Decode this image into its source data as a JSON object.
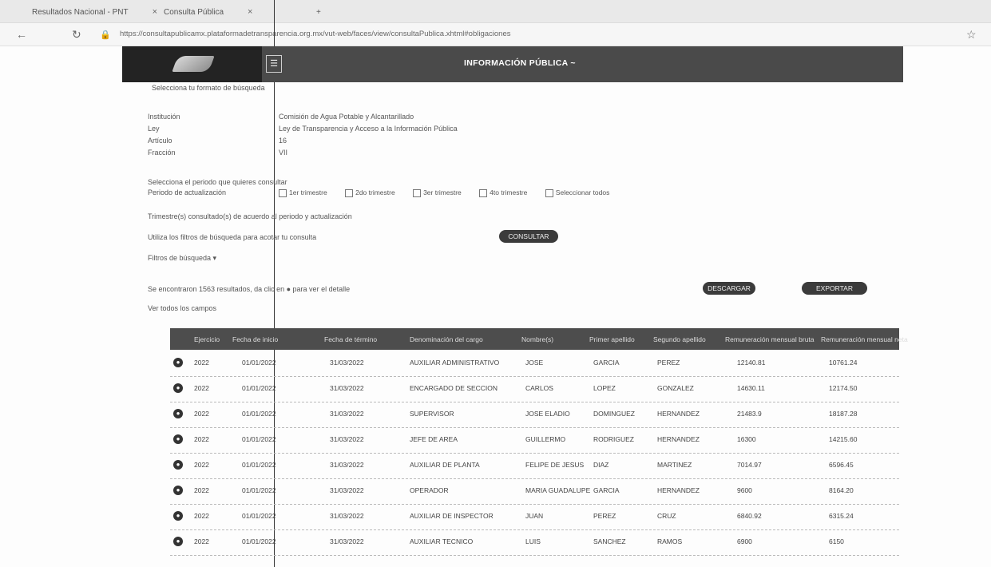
{
  "browser": {
    "tab1": "Resultados Nacional - PNT",
    "tab2": "Consulta Pública",
    "new_tab": "+",
    "url": "https://consultapublicamx.plataformadetransparencia.org.mx/vut-web/faces/view/consultaPublica.xhtml#obligaciones"
  },
  "header": {
    "title": "INFORMACIÓN PÚBLICA ~",
    "menu_icon": "menu-icon"
  },
  "subtitle": "Selecciona tu formato de búsqueda",
  "fields": [
    {
      "label": "Institución",
      "value": "Comisión de Agua Potable y Alcantarillado"
    },
    {
      "label": "Ley",
      "value": "Ley de Transparencia y Acceso a la Información Pública"
    },
    {
      "label": "Artículo",
      "value": "16"
    },
    {
      "label": "Fracción",
      "value": "VII"
    }
  ],
  "period_prompt": "Selecciona el periodo que quieres consultar",
  "period_label": "Periodo de actualización",
  "periods": [
    "1er trimestre",
    "2do trimestre",
    "3er trimestre",
    "4to trimestre",
    "Seleccionar todos"
  ],
  "trimester_note": "Trimestre(s) consultado(s) de acuerdo al periodo y actualización",
  "filter_note": "Utiliza los filtros de búsqueda para acotar tu consulta",
  "filter_toggle": "Filtros de búsqueda ▾",
  "consult_button": "CONSULTAR",
  "results_note": "Se encontraron 1563 resultados, da clic en ● para ver el detalle",
  "all_fields": "Ver todos los campos",
  "download_button": "DESCARGAR",
  "export_button": "EXPORTAR",
  "table": {
    "columns": [
      "Ejercicio",
      "Fecha de inicio",
      "Fecha de término",
      "Denominación del cargo",
      "Nombre(s)",
      "Primer apellido",
      "Segundo apellido",
      "Remuneración mensual bruta",
      "Remuneración mensual neta"
    ],
    "rows": [
      [
        "2022",
        "01/01/2022",
        "31/03/2022",
        "AUXILIAR ADMINISTRATIVO",
        "JOSE",
        "GARCIA",
        "PEREZ",
        "12140.81",
        "10761.24"
      ],
      [
        "2022",
        "01/01/2022",
        "31/03/2022",
        "ENCARGADO DE SECCION",
        "CARLOS",
        "LOPEZ",
        "GONZALEZ",
        "14630.11",
        "12174.50"
      ],
      [
        "2022",
        "01/01/2022",
        "31/03/2022",
        "SUPERVISOR",
        "JOSE ELADIO",
        "DOMINGUEZ",
        "HERNANDEZ",
        "21483.9",
        "18187.28"
      ],
      [
        "2022",
        "01/01/2022",
        "31/03/2022",
        "JEFE DE AREA",
        "GUILLERMO",
        "RODRIGUEZ",
        "HERNANDEZ",
        "16300",
        "14215.60"
      ],
      [
        "2022",
        "01/01/2022",
        "31/03/2022",
        "AUXILIAR DE PLANTA",
        "FELIPE DE JESUS",
        "DIAZ",
        "MARTINEZ",
        "7014.97",
        "6596.45"
      ],
      [
        "2022",
        "01/01/2022",
        "31/03/2022",
        "OPERADOR",
        "MARIA GUADALUPE",
        "GARCIA",
        "HERNANDEZ",
        "9600",
        "8164.20"
      ],
      [
        "2022",
        "01/01/2022",
        "31/03/2022",
        "AUXILIAR DE INSPECTOR",
        "JUAN",
        "PEREZ",
        "CRUZ",
        "6840.92",
        "6315.24"
      ],
      [
        "2022",
        "01/01/2022",
        "31/03/2022",
        "AUXILIAR TECNICO",
        "LUIS",
        "SANCHEZ",
        "RAMOS",
        "6900",
        "6150"
      ]
    ]
  },
  "colors": {
    "header_bg": "#4a4a4a",
    "table_head": "#4d4d4d"
  }
}
